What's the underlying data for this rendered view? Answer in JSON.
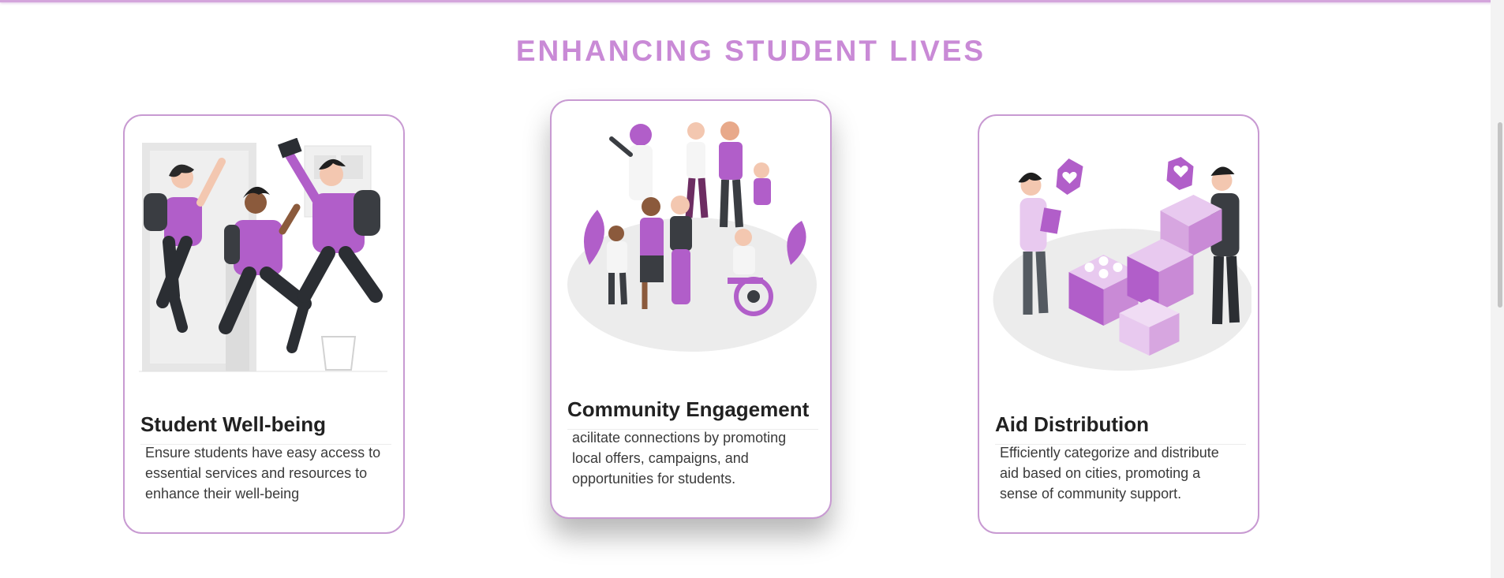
{
  "section": {
    "title": "ENHANCING STUDENT LIVES"
  },
  "cards": [
    {
      "title": "Student Well-being",
      "description": "Ensure students have easy access to essential services and resources to enhance their well-being",
      "illustration": "students-jumping-illustration"
    },
    {
      "title": "Community Engagement",
      "description": "acilitate connections by promoting local offers, campaigns, and opportunities for students.",
      "illustration": "community-group-illustration"
    },
    {
      "title": "Aid Distribution",
      "description": "Efficiently categorize and distribute aid based on cities, promoting a sense of community support.",
      "illustration": "aid-boxes-illustration"
    }
  ],
  "colors": {
    "accent": "#c98ad6",
    "purple": "#b15ec9",
    "dark": "#2b2e33",
    "border": "#c89ad2"
  }
}
